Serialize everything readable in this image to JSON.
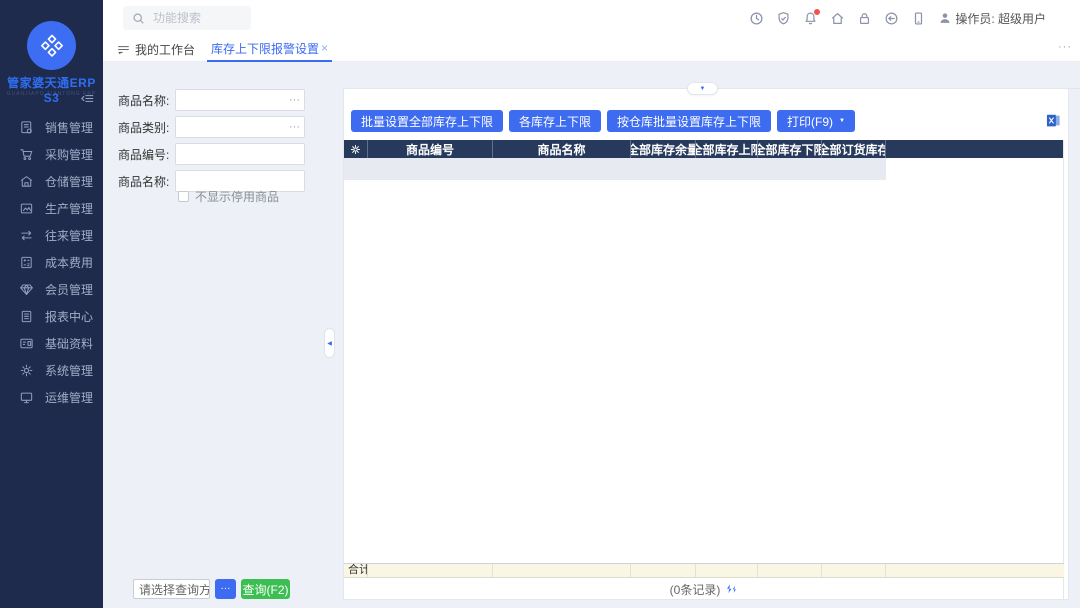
{
  "app": {
    "title": "管家婆天通ERP S3",
    "subtitle": "GUANJIAPO TIANTONG ERP",
    "operator_label": "操作员: 超级用户"
  },
  "topbar": {
    "search_placeholder": "功能搜索",
    "icons": [
      "clock-icon",
      "shield-icon",
      "bell-icon",
      "home-icon",
      "lock-icon",
      "logout-icon",
      "mobile-icon",
      "user-icon"
    ]
  },
  "tabs": {
    "workbench": "我的工作台",
    "current": "库存上下限报警设置",
    "close": "×",
    "more": "···"
  },
  "sidebar": {
    "items": [
      {
        "label": "销售管理",
        "icon": "sales-icon"
      },
      {
        "label": "采购管理",
        "icon": "purchase-icon"
      },
      {
        "label": "仓储管理",
        "icon": "warehouse-icon"
      },
      {
        "label": "生产管理",
        "icon": "production-icon"
      },
      {
        "label": "往来管理",
        "icon": "transactions-icon"
      },
      {
        "label": "成本费用",
        "icon": "cost-icon"
      },
      {
        "label": "会员管理",
        "icon": "member-icon"
      },
      {
        "label": "报表中心",
        "icon": "report-icon"
      },
      {
        "label": "基础资料",
        "icon": "basic-data-icon"
      },
      {
        "label": "系统管理",
        "icon": "system-icon"
      },
      {
        "label": "运维管理",
        "icon": "ops-icon"
      }
    ]
  },
  "filter": {
    "fields": [
      {
        "label": "商品名称:",
        "ellipsis": "···"
      },
      {
        "label": "商品类别:",
        "ellipsis": "···"
      },
      {
        "label": "商品编号:"
      },
      {
        "label": "商品名称:"
      }
    ],
    "checkbox_label": "不显示停用商品",
    "query_select": "请选择查询方",
    "more_button": "···",
    "query_button": "查询(F2)"
  },
  "toolbar": {
    "buttons": [
      "批量设置全部库存上下限",
      "各库存上下限",
      "按仓库批量设置库存上下限"
    ],
    "print_button": "打印(F9)"
  },
  "table": {
    "columns": [
      "商品编号",
      "商品名称",
      "全部库存余量",
      "全部库存上限",
      "全部库存下限",
      "全部订货库存"
    ],
    "sum_label": "合计",
    "record_count": "(0条记录)",
    "rows": []
  },
  "colors": {
    "accent_blue": "#3e6cf1",
    "green": "#3cbf52",
    "sidebar_bg": "#1e2b4d",
    "table_header_bg": "#273a5c",
    "sum_row_bg": "#f9f6e3",
    "notification_red": "#f0544f"
  }
}
